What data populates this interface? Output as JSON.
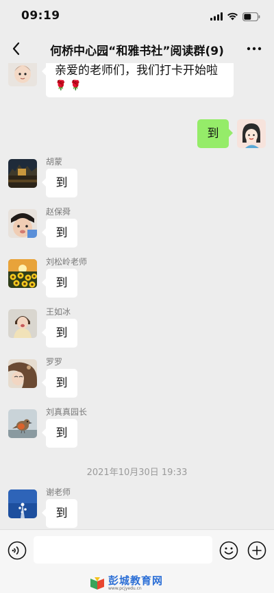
{
  "status": {
    "time": "09:19"
  },
  "header": {
    "title": "何桥中心园“和雅书社”阅读群(9)"
  },
  "messages": [
    {
      "side": "left",
      "sender": "",
      "text": "亲爱的老师们，我们打卡开始啦",
      "extra": "🌹 🌹",
      "avatar": "baby-avatar"
    },
    {
      "side": "right",
      "text": "到",
      "avatar": "cartoon-girl-avatar"
    },
    {
      "side": "left",
      "sender": "胡蒙",
      "text": "到",
      "avatar": "night-lake-avatar"
    },
    {
      "side": "left",
      "sender": "赵保舜",
      "text": "到",
      "avatar": "child-face-avatar"
    },
    {
      "side": "left",
      "sender": "刘松岭老师",
      "text": "到",
      "avatar": "sunflower-avatar"
    },
    {
      "side": "left",
      "sender": "王如冰",
      "text": "到",
      "avatar": "little-girl-avatar"
    },
    {
      "side": "left",
      "sender": "罗罗",
      "text": "到",
      "avatar": "woman-portrait-avatar"
    },
    {
      "side": "left",
      "sender": "刘真真园长",
      "text": "到",
      "avatar": "robin-bird-avatar"
    },
    {
      "side": "left",
      "sender": "谢老师",
      "text": "到",
      "avatar": "blue-sky-avatar"
    }
  ],
  "timestamp": "2021年10月30日 19:33",
  "input": {
    "placeholder": ""
  },
  "watermark": {
    "text": "彭城教育网",
    "sub": "www.pcjyedu.cn"
  },
  "colors": {
    "background": "#ededed",
    "bubble_self": "#95ec69",
    "bubble_other": "#ffffff"
  }
}
